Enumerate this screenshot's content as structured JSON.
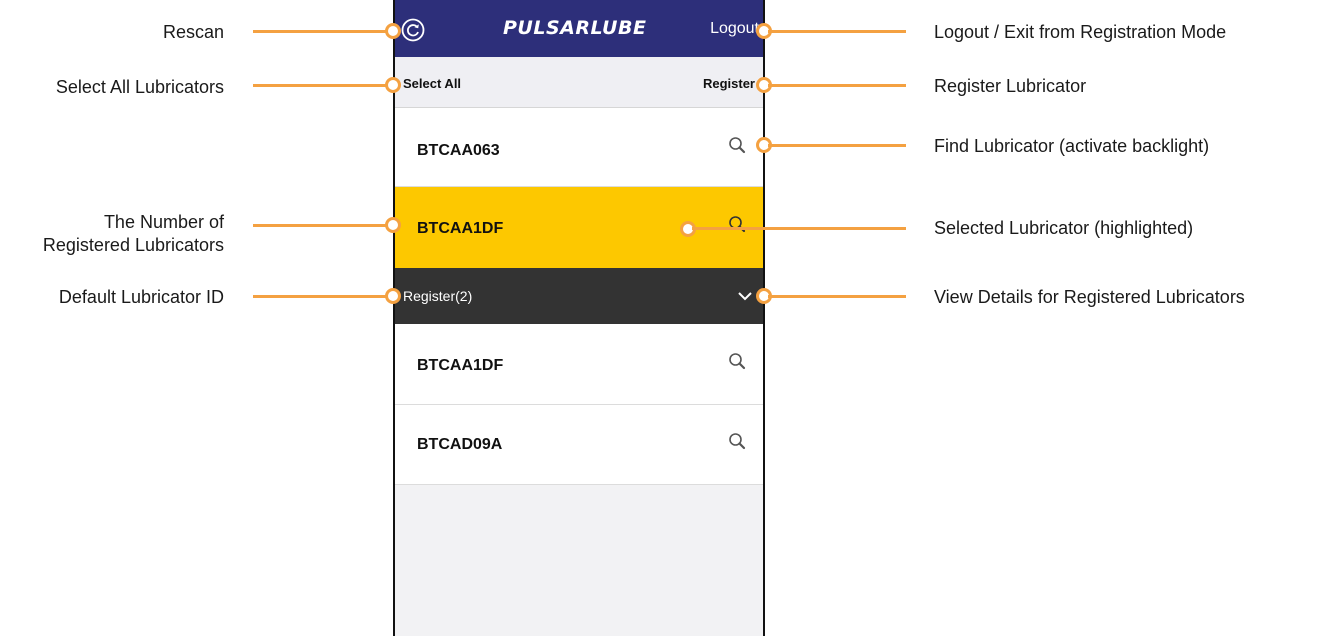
{
  "app": {
    "logo_text": "PULSARLUBE",
    "logout_label": "Logout",
    "select_all_label": "Select All",
    "register_label": "Register"
  },
  "scan_list": [
    {
      "id": "BTCAA063",
      "selected": false
    },
    {
      "id": "BTCAA1DF",
      "selected": true
    }
  ],
  "registered_section": {
    "label": "Register(2)",
    "items": [
      {
        "id": "BTCAA1DF"
      },
      {
        "id": "BTCAD09A"
      }
    ]
  },
  "colors": {
    "header_bg": "#2d2f7a",
    "selected_row_bg": "#fdc800",
    "registered_header_bg": "#333333",
    "annotation_accent": "#f4a141"
  },
  "icons": {
    "rescan": "refresh-icon",
    "find": "search-icon",
    "details": "chevron-down-icon"
  },
  "annotations": {
    "rescan": "Rescan",
    "select_all": "Select All Lubricators",
    "registered_count_line1": "The Number of",
    "registered_count_line2": "Registered Lubricators",
    "default_id": "Default Lubricator ID",
    "logout": "Logout / Exit from Registration Mode",
    "register": "Register Lubricator",
    "find": "Find Lubricator (activate backlight)",
    "selected": "Selected Lubricator (highlighted)",
    "view_details": "View Details for Registered Lubricators"
  }
}
